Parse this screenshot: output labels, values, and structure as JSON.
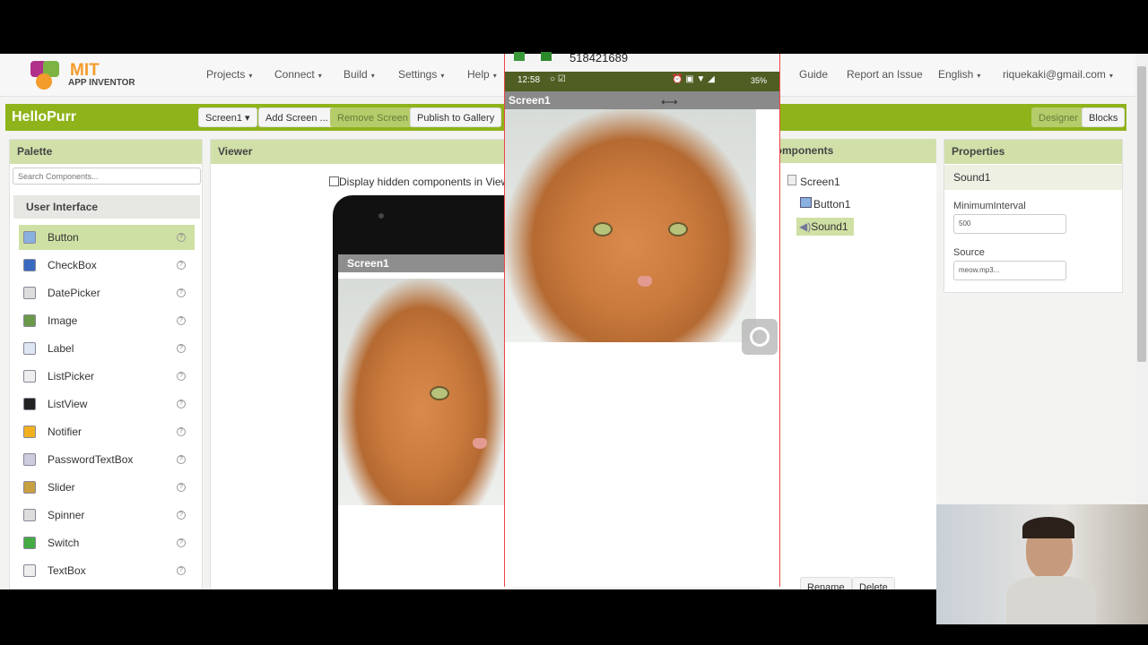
{
  "header": {
    "logo_top": "MIT",
    "logo_bottom": "APP INVENTOR",
    "nav": [
      "Projects",
      "Connect",
      "Build",
      "Settings",
      "Help"
    ],
    "right_nav": [
      "Guide",
      "Report an Issue"
    ],
    "language": "English",
    "account": "riquekaki@gmail.com"
  },
  "project": {
    "title": "HelloPurr",
    "screen_select": "Screen1",
    "add_screen": "Add Screen ...",
    "remove_screen": "Remove Screen",
    "publish": "Publish to Gallery",
    "designer": "Designer",
    "blocks": "Blocks"
  },
  "palette": {
    "title": "Palette",
    "search_placeholder": "Search Components...",
    "category": "User Interface",
    "items": [
      "Button",
      "CheckBox",
      "DatePicker",
      "Image",
      "Label",
      "ListPicker",
      "ListView",
      "Notifier",
      "PasswordTextBox",
      "Slider",
      "Spinner",
      "Switch",
      "TextBox"
    ]
  },
  "viewer": {
    "title": "Viewer",
    "hidden_checkbox": "Display hidden components in Viewer",
    "screen_title": "Screen1"
  },
  "phone_overlay": {
    "address": "518421689",
    "time": "12:58",
    "battery": "35%",
    "screen_title": "Screen1"
  },
  "components": {
    "title": "Components",
    "tree": [
      "Screen1",
      "Button1",
      "Sound1"
    ],
    "selected": "Sound1",
    "rename": "Rename",
    "delete": "Delete"
  },
  "properties": {
    "title": "Properties",
    "component": "Sound1",
    "minimum_interval_label": "MinimumInterval",
    "minimum_interval": "500",
    "source_label": "Source",
    "source": "meow.mp3..."
  },
  "colors": {
    "brand_green": "#8fb31a",
    "panel_header": "#d1e0a9",
    "phone_status": "#4f5e22"
  }
}
